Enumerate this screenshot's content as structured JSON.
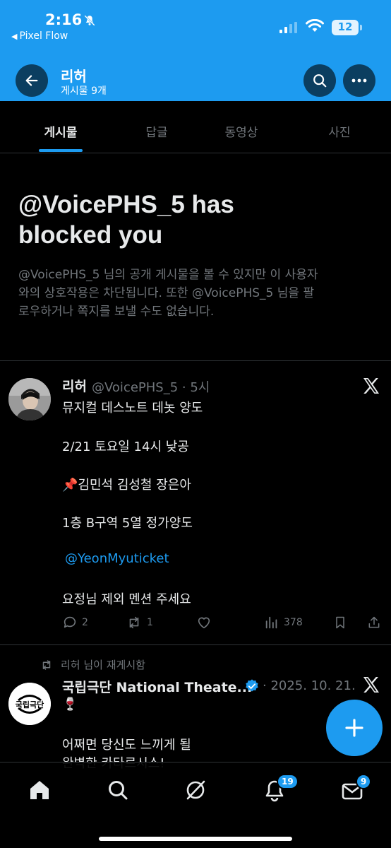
{
  "status_bar": {
    "time": "2:16",
    "back_app": "Pixel Flow",
    "battery": "12"
  },
  "header": {
    "name": "리허",
    "post_count": "게시물 9개"
  },
  "tabs": [
    {
      "label": "게시물",
      "active": true
    },
    {
      "label": "답글",
      "active": false
    },
    {
      "label": "동영상",
      "active": false
    },
    {
      "label": "사진",
      "active": false
    }
  ],
  "blocked": {
    "title_line1": "@VoicePHS_5 has",
    "title_line2": "blocked you",
    "body_line1": "@VoicePHS_5 님의 공개 게시물을 볼 수 있지만 이 사용자",
    "body_line2": "와의 상호작용은 차단됩니다. 또한 @VoicePHS_5 님을 팔",
    "body_line3": "로우하거나 쪽지를 보낼 수도 없습니다."
  },
  "tweet1": {
    "name": "리허",
    "handle_time": "@VoicePHS_5 · 5시",
    "lines": [
      "뮤지컬 데스노트 데놋 양도",
      "2/21 토요일 14시 낮공",
      "📌김민석 김성철 장은아",
      "1층 B구역 5열 정가양도",
      "@YeonMyuticket",
      "요정님 제외 멘션 주세요"
    ],
    "replies": "2",
    "reposts": "1",
    "views": "378"
  },
  "tweet2": {
    "retweeted_by": "리허 님이 재게시함",
    "name": "국립극단 National Theate...",
    "date": "· 2025. 10. 21.",
    "line1": "🍷",
    "line2": "어쩌면 당신도 느끼게 될",
    "line3": "완벽한 카타르시스!",
    "avatar_text": "국립극단"
  },
  "nav": {
    "notifications_badge": "19",
    "messages_badge": "9"
  },
  "colors": {
    "accent": "#1d9bf0",
    "background": "#000000",
    "muted": "#71767b"
  }
}
